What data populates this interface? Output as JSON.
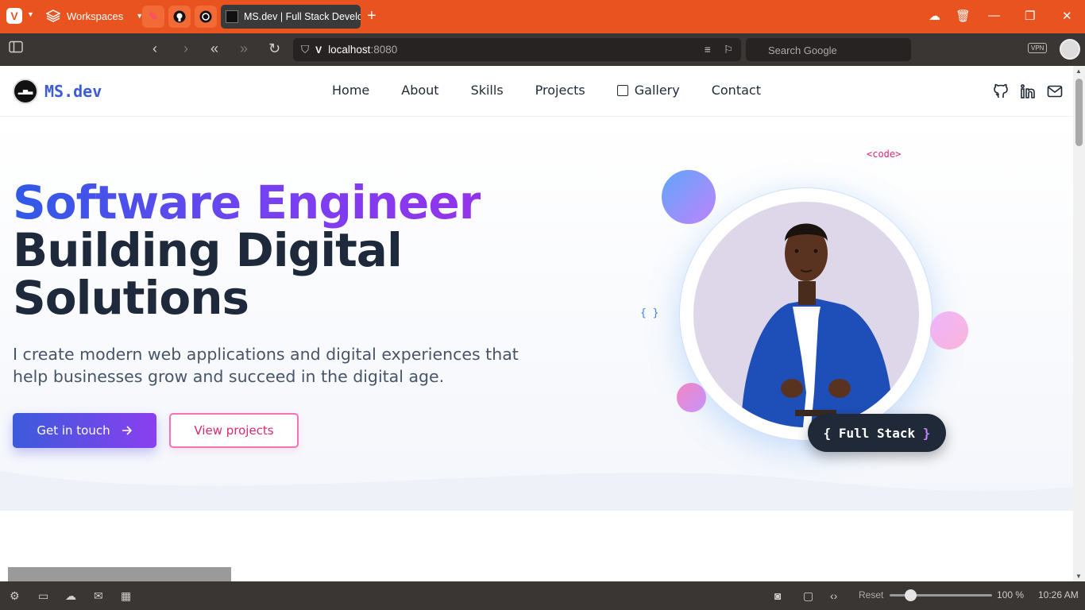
{
  "browser": {
    "workspaces_label": "Workspaces",
    "tab_title": "MS.dev | Full Stack Develop",
    "url_host": "localhost",
    "url_port": ":8080",
    "search_placeholder": "Search Google",
    "vpn_label": "VPN",
    "reset_label": "Reset",
    "zoom_level": "100 %",
    "zoom_fraction": 0.2,
    "clock": "10:26 AM",
    "accent_color": "#e8531f"
  },
  "site": {
    "logo_text": "MS.dev",
    "nav": {
      "home": "Home",
      "about": "About",
      "skills": "Skills",
      "projects": "Projects",
      "gallery": "Gallery",
      "contact": "Contact"
    },
    "socials": [
      "github-icon",
      "linkedin-icon",
      "mail-icon"
    ]
  },
  "hero": {
    "headline_gradient": "Software Engineer",
    "headline_line2": "Building Digital",
    "headline_line3": "Solutions",
    "lead": "I create modern web applications and digital experiences that help businesses grow and succeed in the digital age.",
    "primary_button": "Get in touch",
    "secondary_button": "View projects",
    "code_tag": "<code>",
    "braces": "{ }",
    "badge_open": "{",
    "badge_text": "Full Stack",
    "badge_close": "}",
    "gradient_colors": [
      "#2f5ae6",
      "#9333ea"
    ]
  }
}
